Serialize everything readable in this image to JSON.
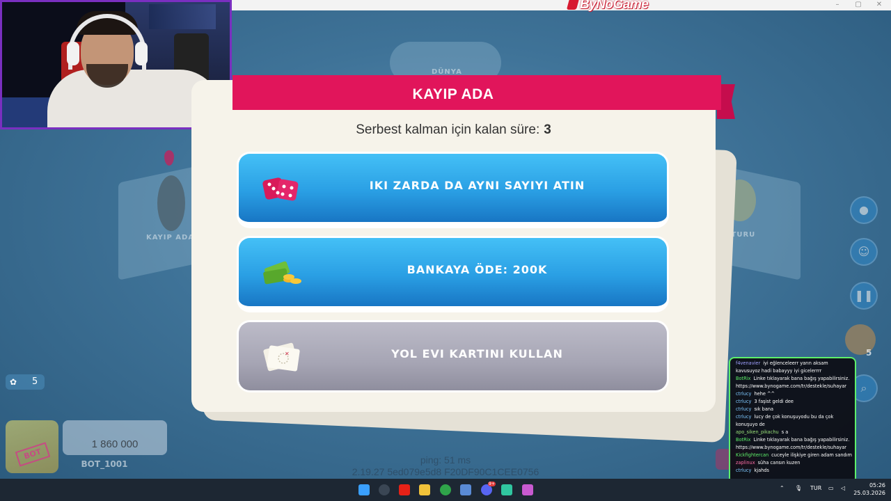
{
  "window": {
    "brand": "ByNoGame"
  },
  "board": {
    "top_label": "DÜNYA",
    "left_label": "KAYIP ADA",
    "right_label": "YA TURU"
  },
  "dialog": {
    "title": "KAYIP ADA",
    "subtitle": "Serbest kalman için kalan süre:",
    "turns_left": "3",
    "options": [
      {
        "label": "IKI ZARDA DA AYNI SAYIYI ATIN",
        "icon": "dice-icon",
        "state": "enabled"
      },
      {
        "label": "BANKAYA ÖDE: 200K",
        "icon": "money-icon",
        "state": "enabled"
      },
      {
        "label": "YOL EVI KARTINI KULLAN",
        "icon": "map-card-icon",
        "state": "disabled"
      }
    ]
  },
  "player": {
    "cards_count": "5",
    "money": "1 860 000",
    "name": "BOT_1001",
    "badge": "BOT"
  },
  "right_panel": {
    "counter": "5"
  },
  "footer": {
    "ping": "ping: 51 ms",
    "version": "2.19.27 5ed079e5d8 F20DF90C1CEE0756"
  },
  "chat": {
    "messages": [
      {
        "user": "f4venavier",
        "color": "#a0a0ff",
        "text": "iyi eğlenceleerr yarın aksam kavusuyoz hadi babayyy iyi gicelerrrr"
      },
      {
        "user": "BotRix",
        "color": "#5ef06a",
        "text": "Linke tıklayarak bana bağış yapabilirsiniz. https://www.bynogame.com/tr/destekle/suhayar"
      },
      {
        "user": "ctrlucy",
        "color": "#7ec8ff",
        "text": "hehe ^^"
      },
      {
        "user": "ctrlucy",
        "color": "#7ec8ff",
        "text": "3 faşist geldi dee"
      },
      {
        "user": "ctrlucy",
        "color": "#7ec8ff",
        "text": "sık bana"
      },
      {
        "user": "ctrlucy",
        "color": "#7ec8ff",
        "text": "lucy de çok konuşuyodu bu da çok konuşuyo de"
      },
      {
        "user": "apo_siken_pikachu",
        "color": "#9be37a",
        "text": "s a"
      },
      {
        "user": "BotRix",
        "color": "#5ef06a",
        "text": "Linke tıklayarak bana bağış yapabilirsiniz. https://www.bynogame.com/tr/destekle/suhayar"
      },
      {
        "user": "Kickfightercan",
        "color": "#5ef06a",
        "text": "cuceyle ilişkiye giren adam sandım"
      },
      {
        "user": "zaplinux",
        "color": "#ff6fa8",
        "text": "süha cansın kuzen"
      },
      {
        "user": "ctrlucy",
        "color": "#7ec8ff",
        "text": "kjahds"
      }
    ]
  },
  "taskbar": {
    "lang": "TUR",
    "time": "05:26",
    "date": "25.03.2026",
    "discord_badge": "9+"
  }
}
